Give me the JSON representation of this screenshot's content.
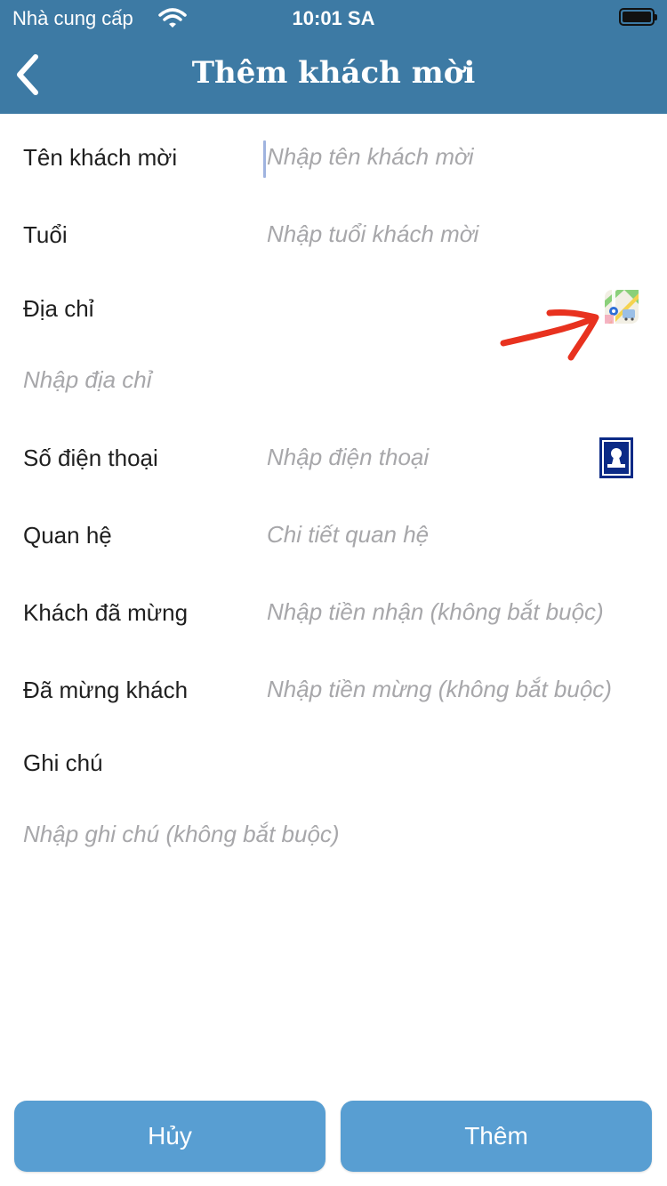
{
  "status_bar": {
    "carrier": "Nhà cung cấp",
    "time": "10:01 SA"
  },
  "nav": {
    "title": "Thêm khách mời",
    "back_icon": "chevron-left-icon"
  },
  "form": {
    "name": {
      "label": "Tên khách mời",
      "placeholder": "Nhập tên khách mời",
      "value": ""
    },
    "age": {
      "label": "Tuổi",
      "placeholder": "Nhập tuổi khách mời",
      "value": ""
    },
    "address": {
      "label": "Địa chỉ",
      "placeholder": "Nhập địa chỉ",
      "value": "",
      "icon": "map-icon"
    },
    "phone": {
      "label": "Số điện thoại",
      "placeholder": "Nhập điện thoại",
      "value": "",
      "icon": "contact-icon"
    },
    "relation": {
      "label": "Quan hệ",
      "placeholder": "Chi tiết quan hệ",
      "value": ""
    },
    "received": {
      "label": "Khách đã mừng",
      "placeholder": "Nhập tiền nhận (không bắt buộc)",
      "value": ""
    },
    "gifted": {
      "label": "Đã mừng khách",
      "placeholder": "Nhập tiền mừng (không bắt buộc)",
      "value": ""
    },
    "note": {
      "label": "Ghi chú",
      "placeholder": "Nhập ghi chú (không bắt buộc)",
      "value": ""
    }
  },
  "buttons": {
    "cancel": "Hủy",
    "add": "Thêm"
  },
  "colors": {
    "header": "#3d7aa4",
    "button": "#589ed2",
    "annotation_arrow": "#e8321f"
  }
}
